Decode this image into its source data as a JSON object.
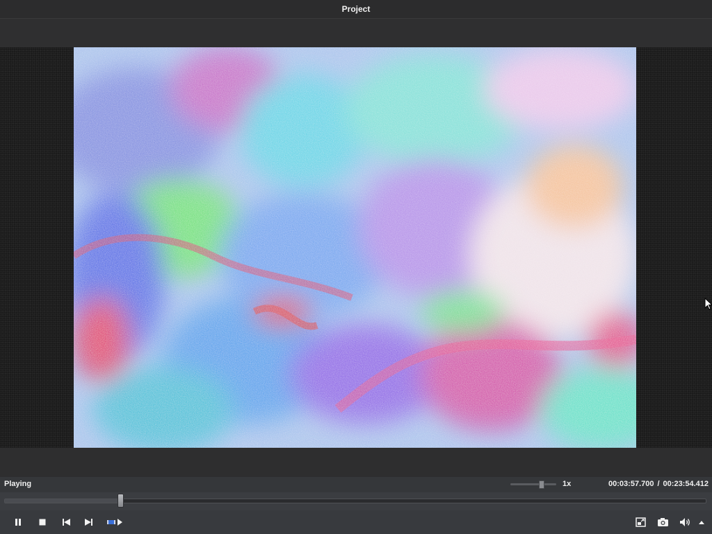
{
  "window": {
    "title": "Project"
  },
  "player": {
    "status": "Playing",
    "speed_label": "1x",
    "speed_level": 0.68,
    "current_time": "00:03:57.700",
    "time_separator": "/",
    "total_time": "00:23:54.412",
    "progress": 0.166
  },
  "controls": {
    "left": [
      "pause-icon",
      "stop-icon",
      "previous-frame-icon",
      "next-frame-icon",
      "play-selection-icon"
    ],
    "right": [
      "fit-to-window-icon",
      "snapshot-icon",
      "volume-icon",
      "volume-menu-icon"
    ]
  },
  "colors": {
    "accent_blue": "#3a6fd8",
    "panel": "#383a3e",
    "background": "#2e2e2f"
  }
}
